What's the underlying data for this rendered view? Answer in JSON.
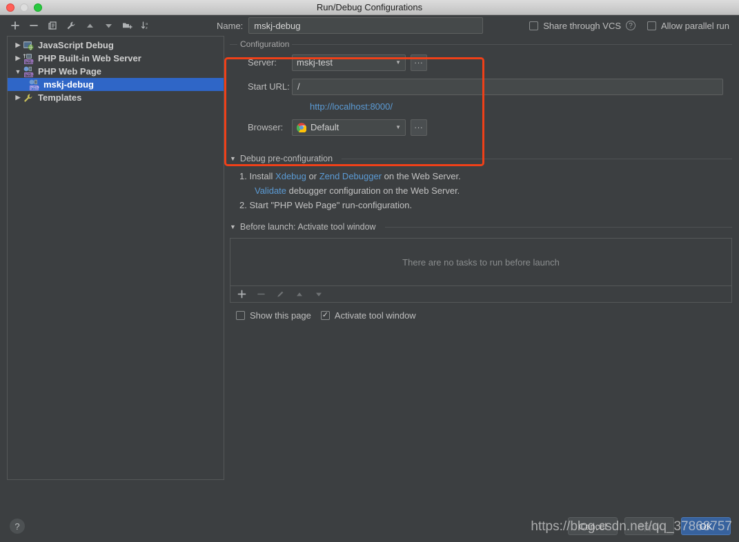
{
  "window": {
    "title": "Run/Debug Configurations",
    "traffic_lights": [
      "close",
      "minimize",
      "zoom"
    ]
  },
  "toolbar": {
    "icons": [
      {
        "name": "add-icon",
        "glyph": "+"
      },
      {
        "name": "remove-icon",
        "glyph": "−"
      },
      {
        "name": "copy-icon",
        "glyph": "copy"
      },
      {
        "name": "edit-templates-icon",
        "glyph": "wrench"
      },
      {
        "name": "move-up-icon",
        "glyph": "▲"
      },
      {
        "name": "move-down-icon",
        "glyph": "▼"
      },
      {
        "name": "new-folder-icon",
        "glyph": "folder-plus"
      },
      {
        "name": "sort-alphabetically-icon",
        "glyph": "sort-az"
      }
    ]
  },
  "name_field": {
    "label": "Name:",
    "value": "mskj-debug",
    "placeholder": ""
  },
  "options": {
    "share_through_vcs": {
      "label": "Share through VCS",
      "checked": false
    },
    "share_help_icon": "?",
    "allow_parallel_run": {
      "label": "Allow parallel run",
      "checked": false
    }
  },
  "sidebar": {
    "items": [
      {
        "label": "JavaScript Debug",
        "expanded": false,
        "selected": false,
        "icon": "javascript-debug-icon",
        "child": false,
        "arrow": "▶"
      },
      {
        "label": "PHP Built-in Web Server",
        "expanded": false,
        "selected": false,
        "icon": "php-builtin-server-icon",
        "child": false,
        "arrow": "▶"
      },
      {
        "label": "PHP Web Page",
        "expanded": true,
        "selected": false,
        "icon": "php-web-page-icon",
        "child": false,
        "arrow": "▼"
      },
      {
        "label": "mskj-debug",
        "expanded": false,
        "selected": true,
        "icon": "php-web-page-icon",
        "child": true,
        "arrow": ""
      },
      {
        "label": "Templates",
        "expanded": false,
        "selected": false,
        "icon": "templates-wrench-icon",
        "child": false,
        "arrow": "▶"
      }
    ]
  },
  "configuration": {
    "group_title": "Configuration",
    "server": {
      "label": "Server:",
      "value": "mskj-test",
      "browse_label": "..."
    },
    "start_url": {
      "label": "Start URL:",
      "value": "/",
      "placeholder": ""
    },
    "resolved_url": "http://localhost:8000/",
    "browser": {
      "label": "Browser:",
      "value": "Default",
      "icon": "chrome-icon",
      "browse_label": "..."
    }
  },
  "debug_pre_configuration": {
    "title": "Debug pre-configuration",
    "expanded": true,
    "step1": {
      "prefix": "1. Install",
      "link1": "Xdebug",
      "middle": "or",
      "link2": "Zend Debugger",
      "suffix": "on the Web Server."
    },
    "step1_sub": {
      "link": "Validate",
      "text": "debugger configuration on the Web Server."
    },
    "step2": "2. Start \"PHP Web Page\" run-configuration."
  },
  "before_launch": {
    "title": "Before launch: Activate tool window",
    "expanded": true,
    "empty_text": "There are no tasks to run before launch",
    "toolbar": [
      {
        "name": "add-task-icon",
        "glyph": "+",
        "enabled": true
      },
      {
        "name": "remove-task-icon",
        "glyph": "−",
        "enabled": false
      },
      {
        "name": "edit-task-icon",
        "glyph": "✎",
        "enabled": false
      },
      {
        "name": "move-task-up-icon",
        "glyph": "▲",
        "enabled": false
      },
      {
        "name": "move-task-down-icon",
        "glyph": "▼",
        "enabled": false
      }
    ],
    "show_this_page": {
      "label": "Show this page",
      "checked": false
    },
    "activate_tool_window": {
      "label": "Activate tool window",
      "checked": true
    }
  },
  "footer": {
    "help_label": "?",
    "cancel_label": "Cancel",
    "apply_label": "Apply",
    "ok_label": "OK"
  },
  "watermark": {
    "text": "https://blog.csdn.net/qq_37868757"
  },
  "colors": {
    "background": "#3c3f41",
    "selection_blue": "#2f66c7",
    "link_blue": "#5b9bd5",
    "highlight_red": "#f04018",
    "primary_button": "#37629e"
  }
}
